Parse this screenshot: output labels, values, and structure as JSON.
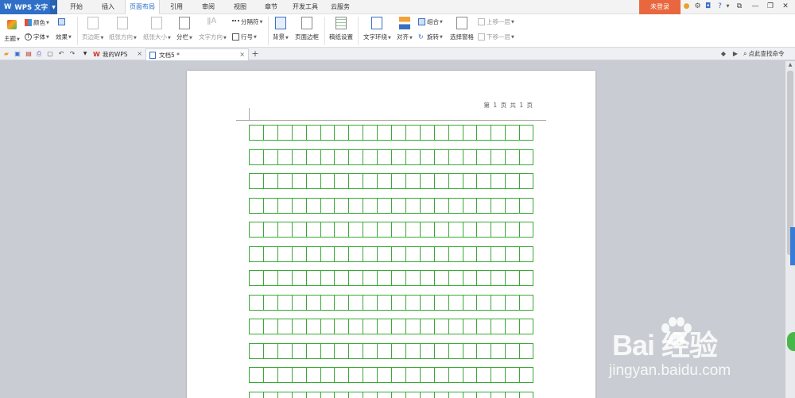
{
  "app": {
    "name": "WPS 文字",
    "logo": "W"
  },
  "menu": {
    "tabs": [
      {
        "label": "开始"
      },
      {
        "label": "插入"
      },
      {
        "label": "页面布局"
      },
      {
        "label": "引用"
      },
      {
        "label": "审阅"
      },
      {
        "label": "视图"
      },
      {
        "label": "章节"
      },
      {
        "label": "开发工具"
      },
      {
        "label": "云服务"
      }
    ],
    "active_tab": "页面布局",
    "login_label": "未登录"
  },
  "ribbon": {
    "theme": "主题",
    "color": "颜色",
    "font": "字体",
    "effect": "效果",
    "margin": "页边距",
    "orientation": "纸张方向",
    "size": "纸张大小",
    "columns": "分栏",
    "text_dir": "文字方向",
    "separator": "分隔符",
    "line_no": "行号",
    "background": "背景",
    "border": "页面边框",
    "draft_paper": "稿纸设置",
    "wrap": "文字环绕",
    "align": "对齐",
    "group": "组合",
    "rotate": "旋转",
    "select_pane": "选择窗格",
    "bring_forward": "上移一层",
    "send_backward": "下移一层"
  },
  "tabs": {
    "home": "我的WPS",
    "doc": "文档5 *",
    "search_cmd": "点此查找命令"
  },
  "document": {
    "header_text": "第 1 页 共 1 页"
  },
  "watermark": {
    "brand": "Bai  经验",
    "url": "jingyan.baidu.com"
  },
  "colors": {
    "accent": "#2f6fc7",
    "login": "#e9673f",
    "grid": "#39a935"
  }
}
